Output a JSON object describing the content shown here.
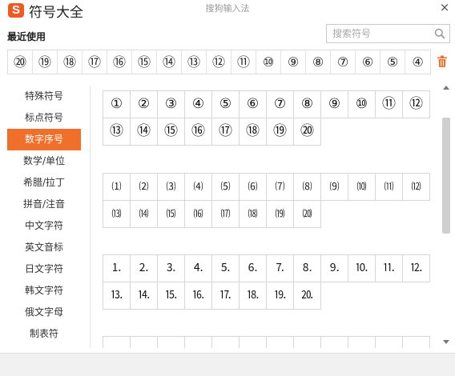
{
  "app": {
    "title": "符号大全",
    "window_title": "搜狗输入法",
    "logo_letter": "S",
    "accent_color": "#f06f2a"
  },
  "recent": {
    "label": "最近使用",
    "items": [
      "⑳",
      "⑲",
      "⑱",
      "⑰",
      "⑯",
      "⑮",
      "⑭",
      "⑬",
      "⑫",
      "⑪",
      "⑩",
      "⑨",
      "⑧",
      "⑦",
      "⑥",
      "⑤",
      "④"
    ]
  },
  "search": {
    "placeholder": "搜索符号",
    "value": ""
  },
  "sidebar": {
    "items": [
      {
        "label": "特殊符号",
        "active": false
      },
      {
        "label": "标点符号",
        "active": false
      },
      {
        "label": "数字序号",
        "active": true
      },
      {
        "label": "数学/单位",
        "active": false
      },
      {
        "label": "希腊/拉丁",
        "active": false
      },
      {
        "label": "拼音/注音",
        "active": false
      },
      {
        "label": "中文字符",
        "active": false
      },
      {
        "label": "英文音标",
        "active": false
      },
      {
        "label": "日文字符",
        "active": false
      },
      {
        "label": "韩文字符",
        "active": false
      },
      {
        "label": "俄文字母",
        "active": false
      },
      {
        "label": "制表符",
        "active": false
      }
    ]
  },
  "groups": [
    {
      "style": "circled",
      "symbols": [
        "①",
        "②",
        "③",
        "④",
        "⑤",
        "⑥",
        "⑦",
        "⑧",
        "⑨",
        "⑩",
        "⑪",
        "⑫",
        "⑬",
        "⑭",
        "⑮",
        "⑯",
        "⑰",
        "⑱",
        "⑲",
        "⑳"
      ]
    },
    {
      "style": "paren",
      "symbols": [
        "⑴",
        "⑵",
        "⑶",
        "⑷",
        "⑸",
        "⑹",
        "⑺",
        "⑻",
        "⑼",
        "⑽",
        "⑾",
        "⑿",
        "⒀",
        "⒁",
        "⒂",
        "⒃",
        "⒄",
        "⒅",
        "⒆",
        "⒇"
      ]
    },
    {
      "style": "dot",
      "symbols": [
        "⒈",
        "⒉",
        "⒊",
        "⒋",
        "⒌",
        "⒍",
        "⒎",
        "⒏",
        "⒐",
        "⒑",
        "⒒",
        "⒓",
        "⒔",
        "⒕",
        "⒖",
        "⒗",
        "⒘",
        "⒙",
        "⒚",
        "⒛"
      ]
    }
  ],
  "icons": {
    "close": "×",
    "search": "search-icon",
    "trash": "trash-icon"
  }
}
